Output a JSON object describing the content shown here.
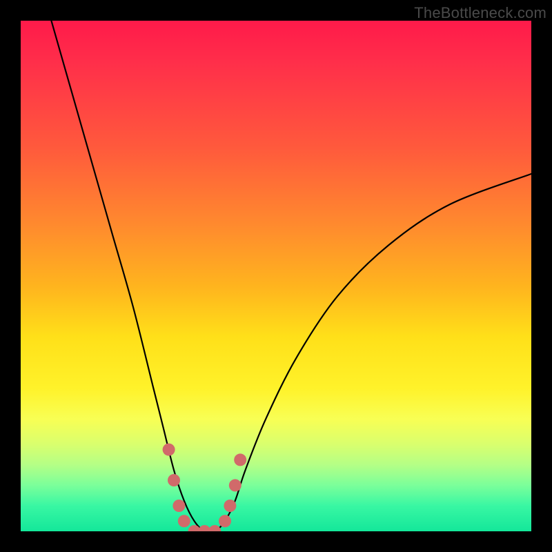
{
  "watermark": "TheBottleneck.com",
  "chart_data": {
    "type": "line",
    "title": "",
    "xlabel": "",
    "ylabel": "",
    "xlim": [
      0,
      100
    ],
    "ylim": [
      0,
      100
    ],
    "grid": false,
    "legend": false,
    "series": [
      {
        "name": "bottleneck-curve",
        "x": [
          6,
          10,
          14,
          18,
          22,
          26,
          28,
          30,
          32,
          34,
          36,
          38,
          40,
          42,
          44,
          48,
          54,
          62,
          72,
          84,
          100
        ],
        "y": [
          100,
          86,
          72,
          58,
          44,
          28,
          20,
          12,
          6,
          2,
          0,
          0,
          2,
          6,
          12,
          22,
          34,
          46,
          56,
          64,
          70
        ]
      }
    ],
    "markers": [
      {
        "x": 29,
        "y": 16
      },
      {
        "x": 30,
        "y": 10
      },
      {
        "x": 31,
        "y": 5
      },
      {
        "x": 32,
        "y": 2
      },
      {
        "x": 34,
        "y": 0
      },
      {
        "x": 36,
        "y": 0
      },
      {
        "x": 38,
        "y": 0
      },
      {
        "x": 40,
        "y": 2
      },
      {
        "x": 41,
        "y": 5
      },
      {
        "x": 42,
        "y": 9
      },
      {
        "x": 43,
        "y": 14
      }
    ],
    "marker_color": "#d16a6a",
    "curve_color": "#000000",
    "background_gradient": [
      "#ff1a4a",
      "#ffe019",
      "#14e79a"
    ]
  }
}
